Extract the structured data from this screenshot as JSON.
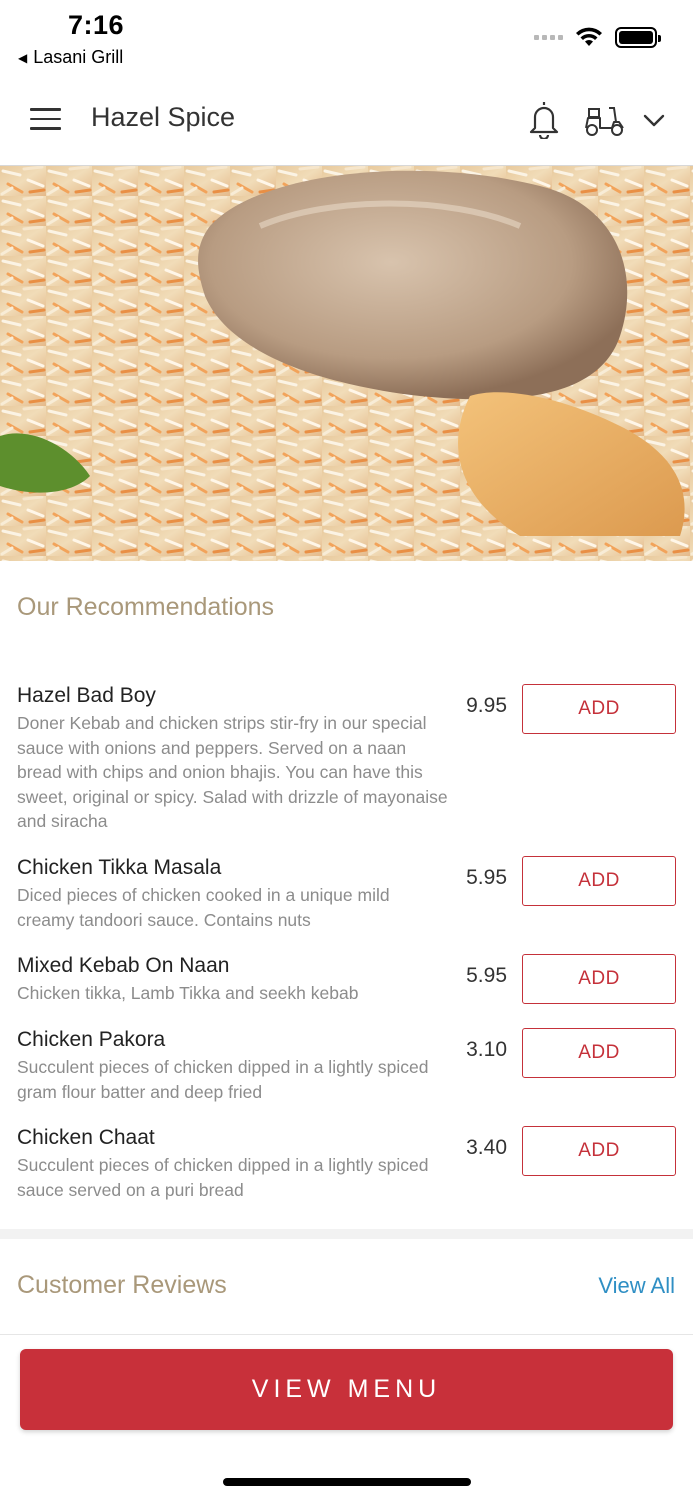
{
  "status_bar": {
    "time": "7:16",
    "back_app": "Lasani Grill"
  },
  "header": {
    "title": "Hazel Spice"
  },
  "hero": {
    "image": "chicken-biryani-photo"
  },
  "recommendations": {
    "title": "Our Recommendations",
    "items": [
      {
        "name": "Hazel Bad Boy",
        "description": "Doner Kebab and chicken strips stir-fry in our special sauce with onions and peppers. Served on a naan bread with chips and onion bhajis. You can have this sweet, original or spicy. Salad with drizzle of mayonaise and siracha",
        "price": "9.95",
        "add_label": "ADD"
      },
      {
        "name": "Chicken Tikka Masala",
        "description": "Diced pieces of chicken cooked in a unique mild creamy tandoori sauce. Contains nuts",
        "price": "5.95",
        "add_label": "ADD"
      },
      {
        "name": "Mixed Kebab On Naan",
        "description": "Chicken tikka, Lamb Tikka and seekh kebab",
        "price": "5.95",
        "add_label": "ADD"
      },
      {
        "name": "Chicken Pakora",
        "description": "Succulent pieces of chicken dipped in a lightly spiced gram flour batter and deep fried",
        "price": "3.10",
        "add_label": "ADD"
      },
      {
        "name": "Chicken Chaat",
        "description": "Succulent pieces of chicken dipped in a lightly spiced sauce served on a puri bread",
        "price": "3.40",
        "add_label": "ADD"
      }
    ]
  },
  "reviews": {
    "title": "Customer Reviews",
    "view_all": "View All"
  },
  "footer": {
    "view_menu": "VIEW MENU"
  },
  "colors": {
    "accent_red": "#c8303a",
    "section_title": "#a9987a",
    "link_blue": "#2f8fc4"
  }
}
